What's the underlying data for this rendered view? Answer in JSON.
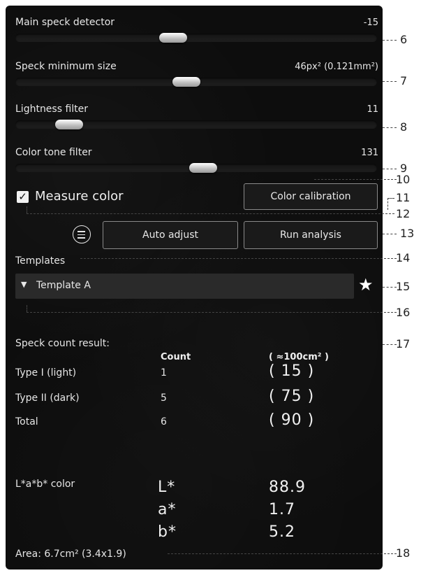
{
  "sliders": [
    {
      "label": "Main speck detector",
      "value": "-15",
      "fraction": 0.43
    },
    {
      "label": "Speck minimum size",
      "value": "46px² (0.121mm²)",
      "fraction": 0.47
    },
    {
      "label": "Lightness filter",
      "value": "11",
      "fraction": 0.12
    },
    {
      "label": "Color tone filter",
      "value": "131",
      "fraction": 0.52
    }
  ],
  "measure_color": {
    "label": "Measure color",
    "checked": true,
    "check_glyph": "✓"
  },
  "buttons": {
    "color_calibration": "Color calibration",
    "auto_adjust": "Auto adjust",
    "run_analysis": "Run analysis"
  },
  "templates": {
    "heading": "Templates",
    "selected": "Template A",
    "expand_glyph": "▼",
    "favorite_glyph": "★"
  },
  "results": {
    "heading": "Speck count result:",
    "col_count": "Count",
    "col_area": "( ≈100cm² )",
    "rows": [
      {
        "label": "Type I (light)",
        "count": "1",
        "scaled": "( 15 )"
      },
      {
        "label": "Type II (dark)",
        "count": "5",
        "scaled": "( 75 )"
      },
      {
        "label": "Total",
        "count": "6",
        "scaled": "( 90 )"
      }
    ]
  },
  "lab": {
    "label": "L*a*b* color",
    "rows": [
      {
        "name": "L*",
        "value": "88.9"
      },
      {
        "name": "a*",
        "value": "1.7"
      },
      {
        "name": "b*",
        "value": "5.2"
      }
    ]
  },
  "area": "Area: 6.7cm² (3.4x1.9)",
  "callouts": [
    "6",
    "7",
    "8",
    "9",
    "10",
    "11",
    "12",
    "13",
    "14",
    "15",
    "16",
    "17",
    "18"
  ]
}
